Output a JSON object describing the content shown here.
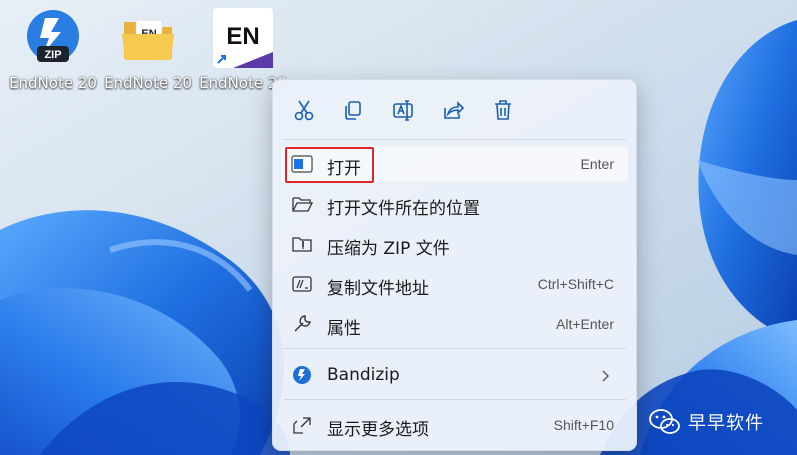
{
  "desktop": {
    "icons": [
      {
        "label": "EndNote 20",
        "badge": "ZIP",
        "icon": "bandizip-zip-icon"
      },
      {
        "label": "EndNote 20",
        "badge": "EN",
        "icon": "folder-icon"
      },
      {
        "label": "EndNote 20",
        "badge": "EN",
        "icon": "endnote-shortcut-icon"
      }
    ]
  },
  "context_menu": {
    "toolbar": [
      "cut-icon",
      "copy-icon",
      "rename-icon",
      "share-icon",
      "delete-icon"
    ],
    "items": [
      {
        "label": "打开",
        "shortcut": "Enter",
        "icon": "open-app-icon",
        "highlighted": true
      },
      {
        "label": "打开文件所在的位置",
        "shortcut": "",
        "icon": "folder-open-icon"
      },
      {
        "label": "压缩为 ZIP 文件",
        "shortcut": "",
        "icon": "zip-folder-icon"
      },
      {
        "label": "复制文件地址",
        "shortcut": "Ctrl+Shift+C",
        "icon": "copy-path-icon"
      },
      {
        "label": "属性",
        "shortcut": "Alt+Enter",
        "icon": "wrench-icon"
      },
      {
        "label": "Bandizip",
        "shortcut": "",
        "icon": "bandizip-icon",
        "submenu": true
      },
      {
        "label": "显示更多选项",
        "shortcut": "Shift+F10",
        "icon": "more-options-icon"
      }
    ]
  },
  "watermark": {
    "text": "早早软件",
    "icon": "wechat-icon"
  },
  "colors": {
    "highlight_box": "#e0262a",
    "wallpaper_blue": "#1f6fe0"
  }
}
